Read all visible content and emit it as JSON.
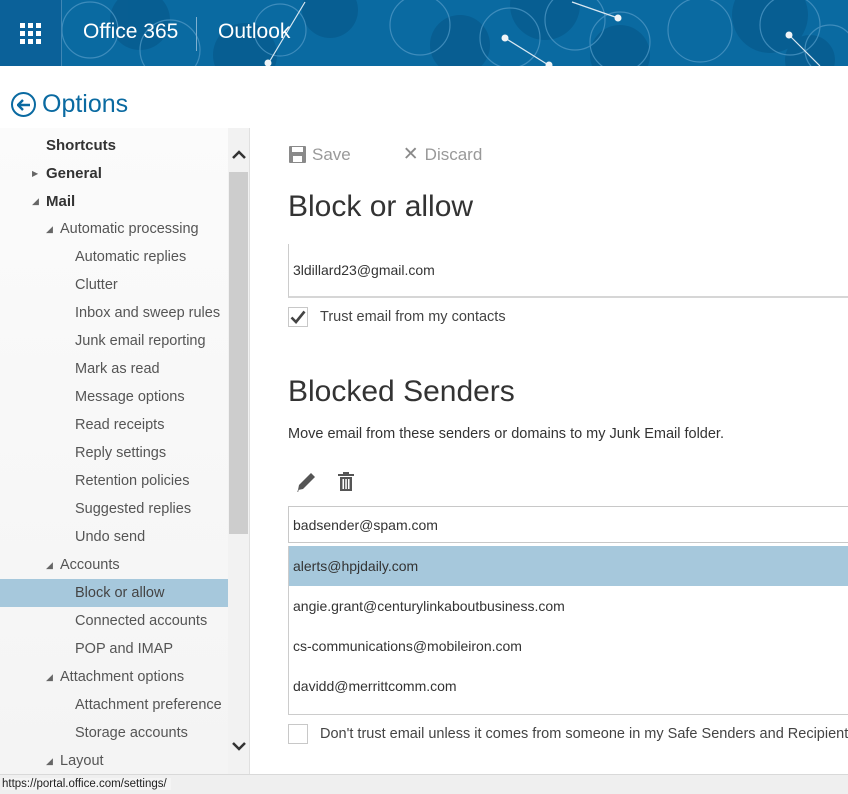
{
  "header": {
    "suite_name": "Office 365",
    "app_name": "Outlook",
    "brand_color": "#0a6aa1"
  },
  "options": {
    "title": "Options",
    "back_icon": "back-arrow-circle-icon"
  },
  "sidebar": {
    "items": [
      {
        "label": "Shortcuts",
        "level": 0,
        "expander": "none"
      },
      {
        "label": "General",
        "level": 0,
        "expander": "collapsed"
      },
      {
        "label": "Mail",
        "level": 0,
        "expander": "expanded"
      },
      {
        "label": "Automatic processing",
        "level": 1,
        "expander": "expanded"
      },
      {
        "label": "Automatic replies",
        "level": 2,
        "expander": "none"
      },
      {
        "label": "Clutter",
        "level": 2,
        "expander": "none"
      },
      {
        "label": "Inbox and sweep rules",
        "level": 2,
        "expander": "none"
      },
      {
        "label": "Junk email reporting",
        "level": 2,
        "expander": "none"
      },
      {
        "label": "Mark as read",
        "level": 2,
        "expander": "none"
      },
      {
        "label": "Message options",
        "level": 2,
        "expander": "none"
      },
      {
        "label": "Read receipts",
        "level": 2,
        "expander": "none"
      },
      {
        "label": "Reply settings",
        "level": 2,
        "expander": "none"
      },
      {
        "label": "Retention policies",
        "level": 2,
        "expander": "none"
      },
      {
        "label": "Suggested replies",
        "level": 2,
        "expander": "none"
      },
      {
        "label": "Undo send",
        "level": 2,
        "expander": "none"
      },
      {
        "label": "Accounts",
        "level": 1,
        "expander": "expanded"
      },
      {
        "label": "Block or allow",
        "level": 2,
        "expander": "none",
        "selected": true
      },
      {
        "label": "Connected accounts",
        "level": 2,
        "expander": "none"
      },
      {
        "label": "POP and IMAP",
        "level": 2,
        "expander": "none"
      },
      {
        "label": "Attachment options",
        "level": 1,
        "expander": "expanded"
      },
      {
        "label": "Attachment preference",
        "level": 2,
        "expander": "none"
      },
      {
        "label": "Storage accounts",
        "level": 2,
        "expander": "none"
      },
      {
        "label": "Layout",
        "level": 1,
        "expander": "expanded"
      }
    ],
    "selected_color": "#a6c8dc"
  },
  "toolbar": {
    "save_label": "Save",
    "discard_label": "Discard"
  },
  "main": {
    "title": "Block or allow",
    "allowed_list": [
      "3ldillard23@gmail.com"
    ],
    "trust_contacts_label": "Trust email from my contacts",
    "trust_contacts_checked": true,
    "blocked_title": "Blocked Senders",
    "blocked_description": "Move email from these senders or domains to my Junk Email folder.",
    "blocked_input_value": "badsender@spam.com",
    "blocked_list": [
      {
        "email": "alerts@hpjdaily.com",
        "selected": true
      },
      {
        "email": "angie.grant@centurylinkaboutbusiness.com",
        "selected": false
      },
      {
        "email": "cs-communications@mobileiron.com",
        "selected": false
      },
      {
        "email": "davidd@merrittcomm.com",
        "selected": false
      }
    ],
    "safe_only_label": "Don't trust email unless it comes from someone in my Safe Senders and Recipients",
    "safe_only_checked": false
  },
  "statusbar": {
    "url": "https://portal.office.com/settings/"
  }
}
